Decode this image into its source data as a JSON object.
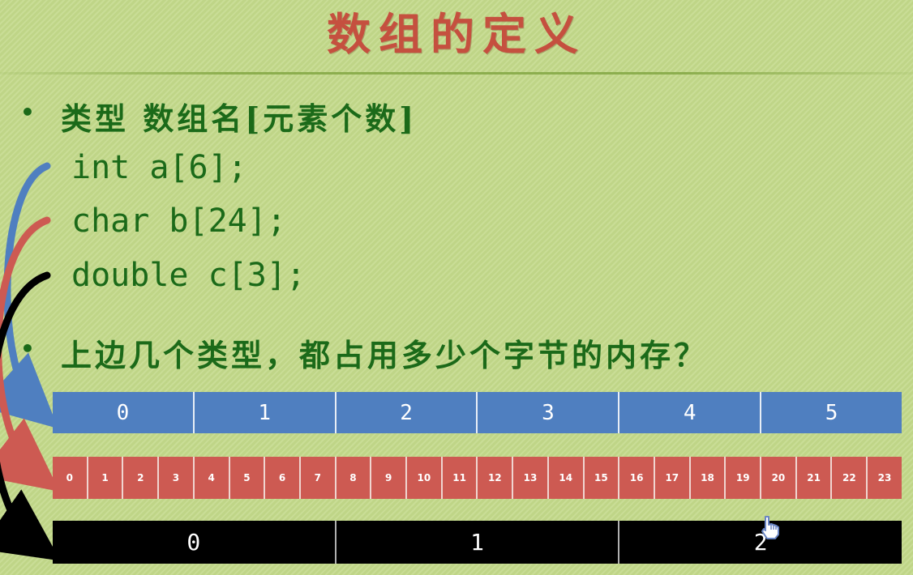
{
  "slide": {
    "title": "数组的定义",
    "bullet_char": "•",
    "heading1": "类型 数组名[元素个数]",
    "code_lines": [
      "int a[6];",
      "char b[24];",
      "double c[3];"
    ],
    "heading2": "上边几个类型，都占用多少个字节的内存？"
  },
  "int_row": [
    "0",
    "1",
    "2",
    "3",
    "4",
    "5"
  ],
  "char_row": [
    "0",
    "1",
    "2",
    "3",
    "4",
    "5",
    "6",
    "7",
    "8",
    "9",
    "10",
    "11",
    "12",
    "13",
    "14",
    "15",
    "16",
    "17",
    "18",
    "19",
    "20",
    "21",
    "22",
    "23"
  ],
  "double_row": [
    "0",
    "1",
    "2"
  ],
  "colors": {
    "background": "#c3d98a",
    "title": "#c5503f",
    "text": "#1b6a19",
    "int_blue": "#4f7fc0",
    "char_red": "#cd5a52",
    "double_black": "#000000"
  },
  "icons": [
    "hand-cursor-icon"
  ]
}
